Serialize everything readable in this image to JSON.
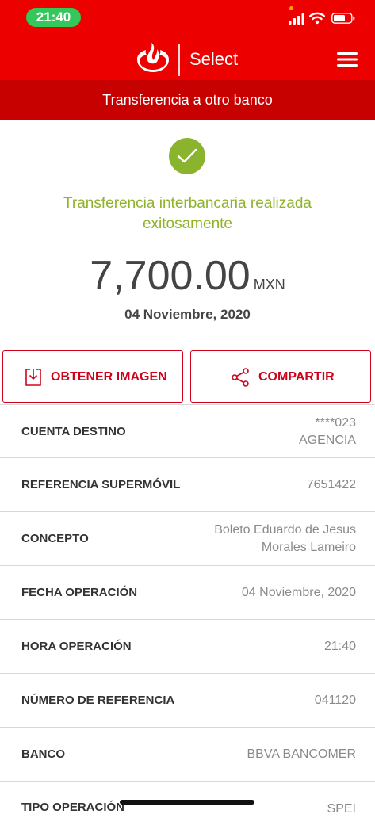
{
  "status_bar": {
    "time": "21:40"
  },
  "header": {
    "brand": "Select",
    "subtitle": "Transferencia a otro banco"
  },
  "confirmation": {
    "message": "Transferencia interbancaria realizada exitosamente",
    "amount": "7,700.00",
    "currency": "MXN",
    "date": "04 Noviembre, 2020"
  },
  "actions": {
    "image_label": "OBTENER IMAGEN",
    "share_label": "COMPARTIR"
  },
  "details": [
    {
      "label": "CUENTA DESTINO",
      "value": "****023\nAGENCIA"
    },
    {
      "label": "REFERENCIA SUPERMÓVIL",
      "value": "7651422"
    },
    {
      "label": "CONCEPTO",
      "value": "Boleto Eduardo de Jesus\nMorales Lameiro"
    },
    {
      "label": "FECHA OPERACIÓN",
      "value": "04 Noviembre, 2020"
    },
    {
      "label": "HORA OPERACIÓN",
      "value": "21:40"
    },
    {
      "label": "NÚMERO DE REFERENCIA",
      "value": "041120"
    },
    {
      "label": "BANCO",
      "value": "BBVA BANCOMER"
    },
    {
      "label": "TIPO OPERACIÓN",
      "value": "SPEI"
    }
  ],
  "colors": {
    "brand_red": "#ec0000",
    "subtitle_red": "#c70000",
    "success_green": "#8bb42e"
  },
  "icons": [
    "santander-flame-icon",
    "menu-icon",
    "check-icon",
    "download-image-icon",
    "share-icon"
  ]
}
